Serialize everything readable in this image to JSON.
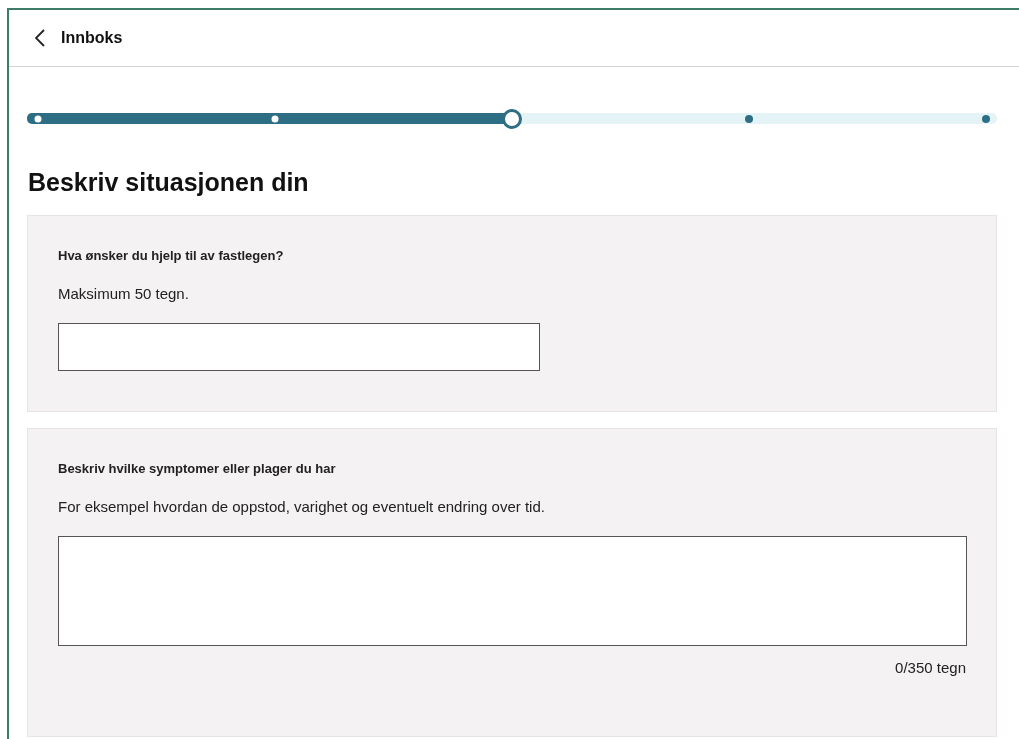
{
  "header": {
    "back_label": "Innboks"
  },
  "progress": {
    "level": 0.5,
    "steps": [
      {
        "kind": "done"
      },
      {
        "kind": "done"
      },
      {
        "kind": "current"
      },
      {
        "kind": "upcoming"
      },
      {
        "kind": "upcoming"
      }
    ]
  },
  "title": "Beskriv situasjonen din",
  "questions": [
    {
      "kind": "input",
      "label": "Hva ønsker du hjelp til av fastlegen?",
      "hint": "Maksimum 50 tegn."
    },
    {
      "kind": "textarea",
      "label": "Beskriv hvilke symptomer eller plager du har",
      "hint": "For eksempel hvordan de oppstod, varighet og eventuelt endring over tid.",
      "counter": "0/350 tegn"
    }
  ]
}
